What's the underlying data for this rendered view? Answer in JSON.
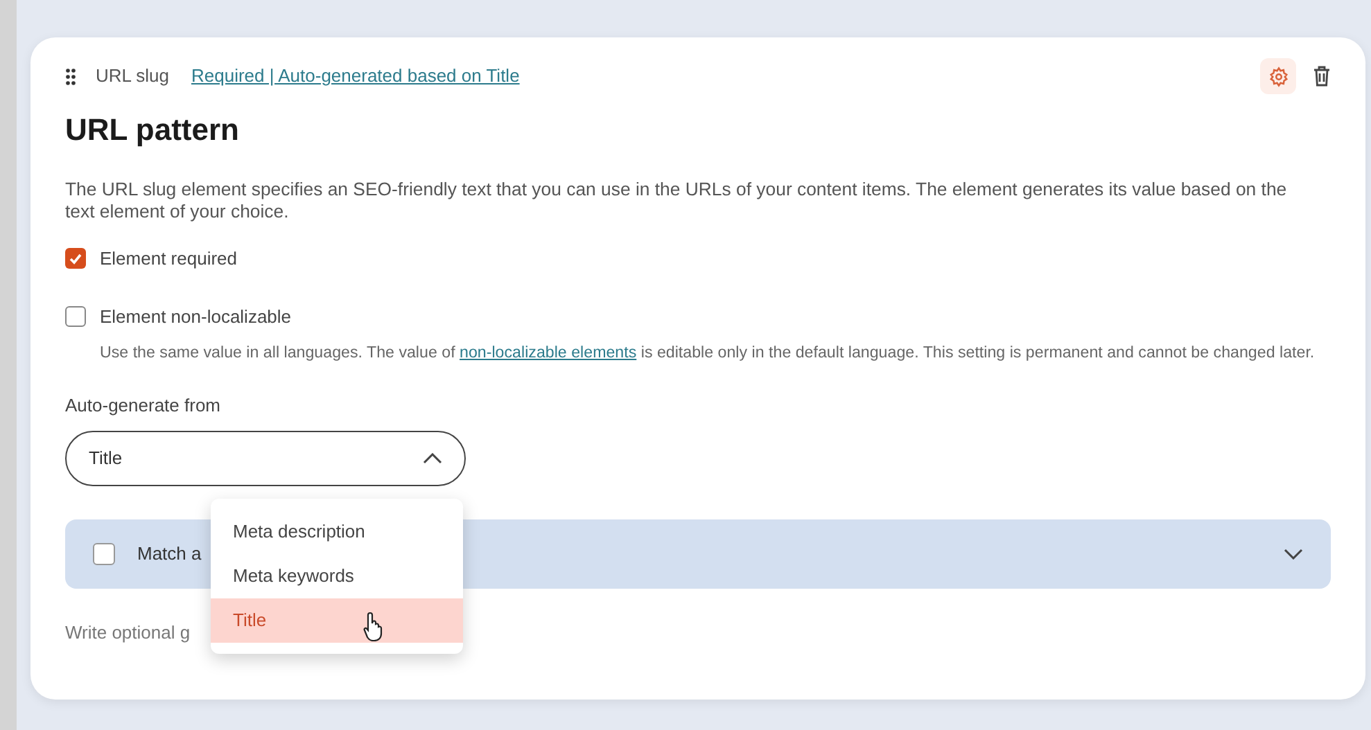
{
  "header": {
    "type_label": "URL slug",
    "summary_link": "Required | Auto-generated based on Title"
  },
  "title": "URL pattern",
  "description": "The URL slug element specifies an SEO-friendly text that you can use in the URLs of your content items. The element generates its value based on the text element of your choice.",
  "options": [
    {
      "label": "Element required",
      "checked": true
    },
    {
      "label": "Element non-localizable",
      "checked": false,
      "help_before": "Use the same value in all languages. The value of",
      "help_link": "non-localizable elements",
      "help_after": "is editable only in the default language. This setting is permanent and cannot be changed later."
    }
  ],
  "auto_generate": {
    "label": "Auto-generate from",
    "value": "Title",
    "expanded": true,
    "menu": [
      {
        "label": "Meta description",
        "selected": false
      },
      {
        "label": "Meta keywords",
        "selected": false
      },
      {
        "label": "Title",
        "selected": true
      }
    ]
  },
  "match_panel": {
    "label": "Match a",
    "checked": false
  },
  "guidelines": {
    "placeholder": "Write optional g"
  }
}
